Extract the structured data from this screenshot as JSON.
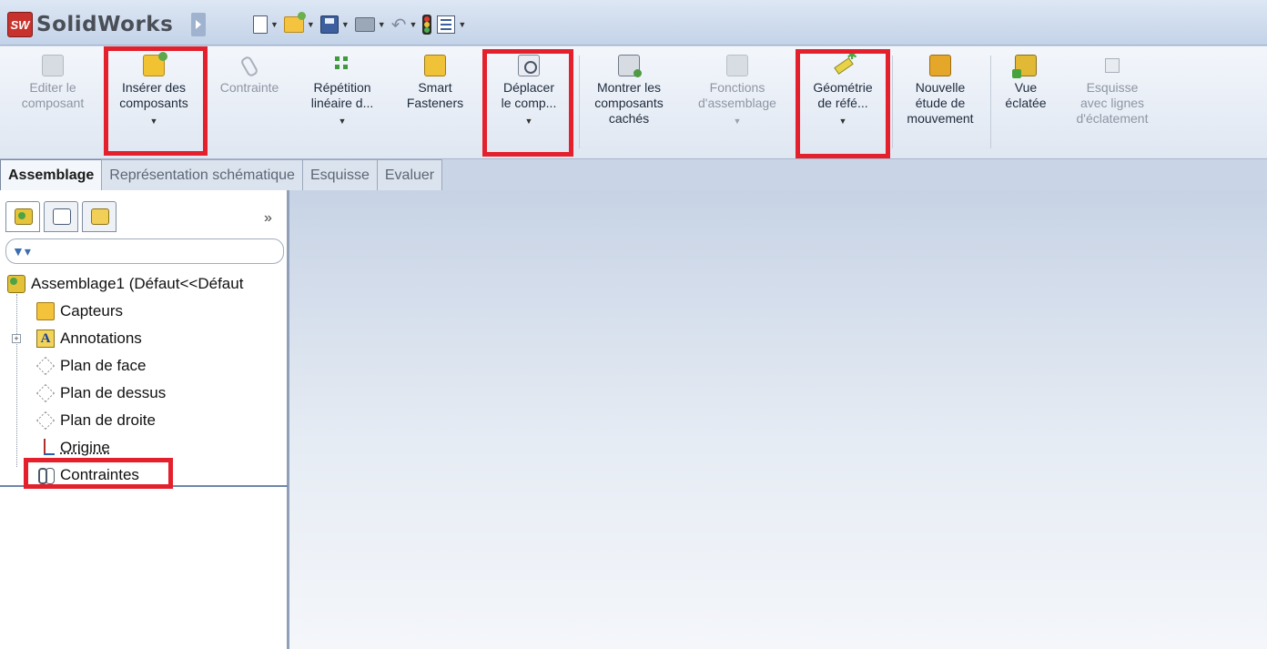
{
  "app": {
    "logo_badge": "SW",
    "name": "SolidWorks"
  },
  "quick_access": [
    "new-document",
    "open-document",
    "save",
    "print",
    "undo",
    "rebuild",
    "options"
  ],
  "ribbon": {
    "buttons": [
      {
        "label": "Editer le\ncomposant",
        "icon": "edit-component-icon",
        "enabled": false,
        "dropdown": false
      },
      {
        "label": "Insérer des\ncomposants",
        "icon": "insert-components-icon",
        "enabled": true,
        "dropdown": true,
        "highlighted": true
      },
      {
        "label": "Contrainte",
        "icon": "mate-icon",
        "enabled": false,
        "dropdown": false
      },
      {
        "label": "Répétition\nlinéaire d...",
        "icon": "linear-pattern-icon",
        "enabled": true,
        "dropdown": true
      },
      {
        "label": "Smart\nFasteners",
        "icon": "smart-fasteners-icon",
        "enabled": true,
        "dropdown": false
      },
      {
        "label": "Déplacer\nle comp...",
        "icon": "move-component-icon",
        "enabled": true,
        "dropdown": true,
        "highlighted": true
      },
      {
        "label": "Montrer les\ncomposants\ncachés",
        "icon": "show-hidden-icon",
        "enabled": true,
        "dropdown": false
      },
      {
        "label": "Fonctions\nd'assemblage",
        "icon": "assembly-features-icon",
        "enabled": false,
        "dropdown": true
      },
      {
        "label": "Géométrie\nde réfé...",
        "icon": "reference-geometry-icon",
        "enabled": true,
        "dropdown": true,
        "highlighted": true
      },
      {
        "label": "Nouvelle\nétude de\nmouvement",
        "icon": "motion-study-icon",
        "enabled": true,
        "dropdown": false
      },
      {
        "label": "Vue\néclatée",
        "icon": "exploded-view-icon",
        "enabled": true,
        "dropdown": false
      },
      {
        "label": "Esquisse\navec lignes\nd'éclatement",
        "icon": "explode-line-sketch-icon",
        "enabled": false,
        "dropdown": false
      }
    ]
  },
  "tabs": [
    {
      "label": "Assemblage",
      "active": true
    },
    {
      "label": "Représentation schématique",
      "active": false
    },
    {
      "label": "Esquisse",
      "active": false
    },
    {
      "label": "Evaluer",
      "active": false
    }
  ],
  "feature_manager": {
    "panel_tabs": [
      "feature-tree-icon",
      "property-manager-icon",
      "configuration-manager-icon"
    ],
    "more": "»",
    "filter_icon": "filter-icon",
    "root": "Assemblage1  (Défaut<<Défaut",
    "items": [
      {
        "label": "Capteurs",
        "icon": "sensors-icon",
        "expandable": false
      },
      {
        "label": "Annotations",
        "icon": "annotations-icon",
        "expandable": true
      },
      {
        "label": "Plan de face",
        "icon": "plane-icon",
        "expandable": false
      },
      {
        "label": "Plan de dessus",
        "icon": "plane-icon",
        "expandable": false
      },
      {
        "label": "Plan de droite",
        "icon": "plane-icon",
        "expandable": false
      },
      {
        "label": "Origine",
        "icon": "origin-icon",
        "expandable": false
      },
      {
        "label": "Contraintes",
        "icon": "mates-icon",
        "expandable": false,
        "highlighted": true
      }
    ]
  },
  "highlight_color": "#e3202b"
}
